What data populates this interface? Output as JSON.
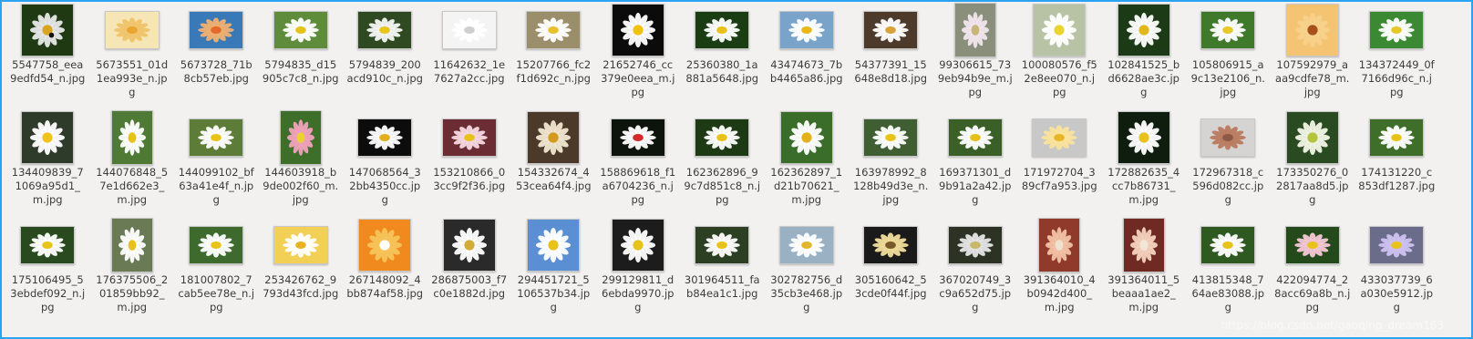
{
  "files": [
    {
      "name": "5547758_eea9edfd54_n.jpg",
      "shape": "sq",
      "bg": "#1f3a12",
      "petal": "#e8e8e8",
      "center": "#d9a520",
      "accent": "#111"
    },
    {
      "name": "5673551_01d1ea993e_n.jpg",
      "shape": "land",
      "bg": "#f7e6b5",
      "petal": "#f0c36a",
      "center": "#e8a530"
    },
    {
      "name": "5673728_71b8cb57eb.jpg",
      "shape": "land",
      "bg": "#3a79b8",
      "petal": "#f0b070",
      "center": "#e46a2a"
    },
    {
      "name": "5794835_d15905c7c8_n.jpg",
      "shape": "land",
      "bg": "#5f8c3a",
      "petal": "#ffffff",
      "center": "#e6c21a"
    },
    {
      "name": "5794839_200acd910c_n.jpg",
      "shape": "land",
      "bg": "#2f4a22",
      "petal": "#f5f5f5",
      "center": "#e8c51d"
    },
    {
      "name": "11642632_1e7627a2cc.jpg",
      "shape": "land",
      "bg": "#f4f4f4",
      "petal": "#ffffff",
      "center": "#cfcfcf"
    },
    {
      "name": "15207766_fc2f1d692c_n.jpg",
      "shape": "land",
      "bg": "#9a8f6a",
      "petal": "#ffffff",
      "center": "#e9c02c"
    },
    {
      "name": "21652746_cc379e0eea_m.jpg",
      "shape": "sq",
      "bg": "#0b0b0b",
      "petal": "#ffffff",
      "center": "#f0c20f"
    },
    {
      "name": "25360380_1a881a5648.jpg",
      "shape": "land",
      "bg": "#1a3d14",
      "petal": "#ffffff",
      "center": "#e8c21a"
    },
    {
      "name": "43474673_7bb4465a86.jpg",
      "shape": "land",
      "bg": "#7aa3c9",
      "petal": "#ffffff",
      "center": "#e8b71c"
    },
    {
      "name": "54377391_15648e8d18.jpg",
      "shape": "land",
      "bg": "#4d3a2a",
      "petal": "#ffffff",
      "center": "#d7a23a"
    },
    {
      "name": "99306615_739eb94b9e_m.jpg",
      "shape": "port",
      "bg": "#8a8f7c",
      "petal": "#f2e6ee",
      "center": "#c9b47a"
    },
    {
      "name": "100080576_f52e8ee070_n.jpg",
      "shape": "sq",
      "bg": "#b8c2a4",
      "petal": "#ffffff",
      "center": "#e9d432"
    },
    {
      "name": "102841525_bd6628ae3c.jpg",
      "shape": "sq",
      "bg": "#1c3a16",
      "petal": "#ffffff",
      "center": "#e2b71c"
    },
    {
      "name": "105806915_a9c13e2106_n.jpg",
      "shape": "land",
      "bg": "#3f7a2a",
      "petal": "#ffffff",
      "center": "#e7c826"
    },
    {
      "name": "107592979_aaa9cdfe78_m.jpg",
      "shape": "sq",
      "bg": "#f4c472",
      "petal": "#f7d28a",
      "center": "#a8501c"
    },
    {
      "name": "134372449_0f7166d96c_n.jpg",
      "shape": "land",
      "bg": "#3b8a33",
      "petal": "#ffffff",
      "center": "#e7c82a"
    },
    {
      "name": "134409839_71069a95d1_m.jpg",
      "shape": "sq",
      "bg": "#2e3a2a",
      "petal": "#ffffff",
      "center": "#efc21c"
    },
    {
      "name": "144076848_57e1d662e3_m.jpg",
      "shape": "port",
      "bg": "#4e7a35",
      "petal": "#ffffff",
      "center": "#e8c21a"
    },
    {
      "name": "144099102_bf63a41e4f_n.jpg",
      "shape": "land",
      "bg": "#5d7c38",
      "petal": "#ffffff",
      "center": "#e8c41a"
    },
    {
      "name": "144603918_b9de002f60_m.jpg",
      "shape": "port",
      "bg": "#3d6f2a",
      "petal": "#f2a2bd",
      "center": "#e9d232"
    },
    {
      "name": "147068564_32bb4350cc.jpg",
      "shape": "land",
      "bg": "#0c0c0c",
      "petal": "#ffffff",
      "center": "#e0b020"
    },
    {
      "name": "153210866_03cc9f2f36.jpg",
      "shape": "land",
      "bg": "#6b2c34",
      "petal": "#f7d9e1",
      "center": "#e8c21a"
    },
    {
      "name": "154332674_453cea64f4.jpg",
      "shape": "sq",
      "bg": "#4b3a2a",
      "petal": "#f0e6d0",
      "center": "#d39a1e"
    },
    {
      "name": "158869618_f1a6704236_n.jpg",
      "shape": "land",
      "bg": "#0d140c",
      "petal": "#ffffff",
      "center": "#d32b2b"
    },
    {
      "name": "162362896_99c7d851c8_n.jpg",
      "shape": "land",
      "bg": "#1d3a15",
      "petal": "#ffffff",
      "center": "#e8c21a"
    },
    {
      "name": "162362897_1d21b70621_m.jpg",
      "shape": "sq",
      "bg": "#3a6d2a",
      "petal": "#ffffff",
      "center": "#e2b21a"
    },
    {
      "name": "163978992_8128b49d3e_n.jpg",
      "shape": "land",
      "bg": "#3f5f33",
      "petal": "#ffffff",
      "center": "#e8c41a"
    },
    {
      "name": "169371301_d9b91a2a42.jpg",
      "shape": "land",
      "bg": "#3a6028",
      "petal": "#ffffff",
      "center": "#e6c01a"
    },
    {
      "name": "171972704_389cf7a953.jpg",
      "shape": "land",
      "bg": "#c8c8c8",
      "petal": "#fbe39a",
      "center": "#e8b528"
    },
    {
      "name": "172882635_4cc7b86731_m.jpg",
      "shape": "sq",
      "bg": "#0f1d0f",
      "petal": "#ffffff",
      "center": "#e8c21a"
    },
    {
      "name": "172967318_c596d082cc.jpg",
      "shape": "land",
      "bg": "#d6d4d2",
      "petal": "#b97a5f",
      "center": "#8a5a45"
    },
    {
      "name": "173350276_02817aa8d5.jpg",
      "shape": "sq",
      "bg": "#2a4a22",
      "petal": "#f1f4e6",
      "center": "#b3c43a"
    },
    {
      "name": "174131220_c853df1287.jpg",
      "shape": "land",
      "bg": "#3f6e2a",
      "petal": "#ffffff",
      "center": "#e8c41a"
    },
    {
      "name": "175106495_53ebdef092_n.jpg",
      "shape": "land",
      "bg": "#284a1e",
      "petal": "#ffffff",
      "center": "#e7c51a"
    },
    {
      "name": "176375506_201859bb92_m.jpg",
      "shape": "port",
      "bg": "#6a7a55",
      "petal": "#ffffff",
      "center": "#e8c21a"
    },
    {
      "name": "181007802_7cab5ee78e_n.jpg",
      "shape": "land",
      "bg": "#3e6a2d",
      "petal": "#ffffff",
      "center": "#e8c41a"
    },
    {
      "name": "253426762_9793d43fcd.jpg",
      "shape": "land",
      "bg": "#f2cf55",
      "petal": "#ffffff",
      "center": "#e8b322"
    },
    {
      "name": "267148092_4bb874af58.jpg",
      "shape": "sq",
      "bg": "#f08a1e",
      "petal": "#f6c45a",
      "center": "#ffffff"
    },
    {
      "name": "286875003_f7c0e1882d.jpg",
      "shape": "sq",
      "bg": "#2a2a2a",
      "petal": "#ffffff",
      "center": "#d3ab35"
    },
    {
      "name": "294451721_5106537b34.jpg",
      "shape": "sq",
      "bg": "#5a8fd3",
      "petal": "#ffffff",
      "center": "#e8c21a"
    },
    {
      "name": "299129811_d6ebda9970.jpg",
      "shape": "sq",
      "bg": "#1c1c1c",
      "petal": "#ffffff",
      "center": "#e6c21a"
    },
    {
      "name": "301964511_fab84ea1c1.jpg",
      "shape": "land",
      "bg": "#2c3f22",
      "petal": "#ffffff",
      "center": "#e8c21a"
    },
    {
      "name": "302782756_d35cb3e468.jpg",
      "shape": "land",
      "bg": "#9ab1c4",
      "petal": "#ffffff",
      "center": "#e0b72a"
    },
    {
      "name": "305160642_53cde0f44f.jpg",
      "shape": "land",
      "bg": "#1a1a1a",
      "petal": "#f2dd9a",
      "center": "#7a5a2a"
    },
    {
      "name": "367020749_3c9a652d75.jpg",
      "shape": "land",
      "bg": "#2c3325",
      "petal": "#e6e6e6",
      "center": "#c7b86a"
    },
    {
      "name": "391364010_4b0942d400_m.jpg",
      "shape": "port",
      "bg": "#8f3a2a",
      "petal": "#f3c2a7",
      "center": "#f0e2d0"
    },
    {
      "name": "391364011_5beaaa1ae2_m.jpg",
      "shape": "port",
      "bg": "#6f2a24",
      "petal": "#f4d2bf",
      "center": "#f2e6d8"
    },
    {
      "name": "413815348_764ae83088.jpg",
      "shape": "land",
      "bg": "#2e5a22",
      "petal": "#ffffff",
      "center": "#e8c21a"
    },
    {
      "name": "422094774_28acc69a8b_n.jpg",
      "shape": "land",
      "bg": "#244a1c",
      "petal": "#f6c7d7",
      "center": "#e8c21a"
    },
    {
      "name": "433037739_6a030e5912.jpg",
      "shape": "land",
      "bg": "#6b6b8a",
      "petal": "#cfc3f0",
      "center": "#e8c21a"
    }
  ],
  "watermark": "https://blog.csdn.net/gaoqing_dream163"
}
